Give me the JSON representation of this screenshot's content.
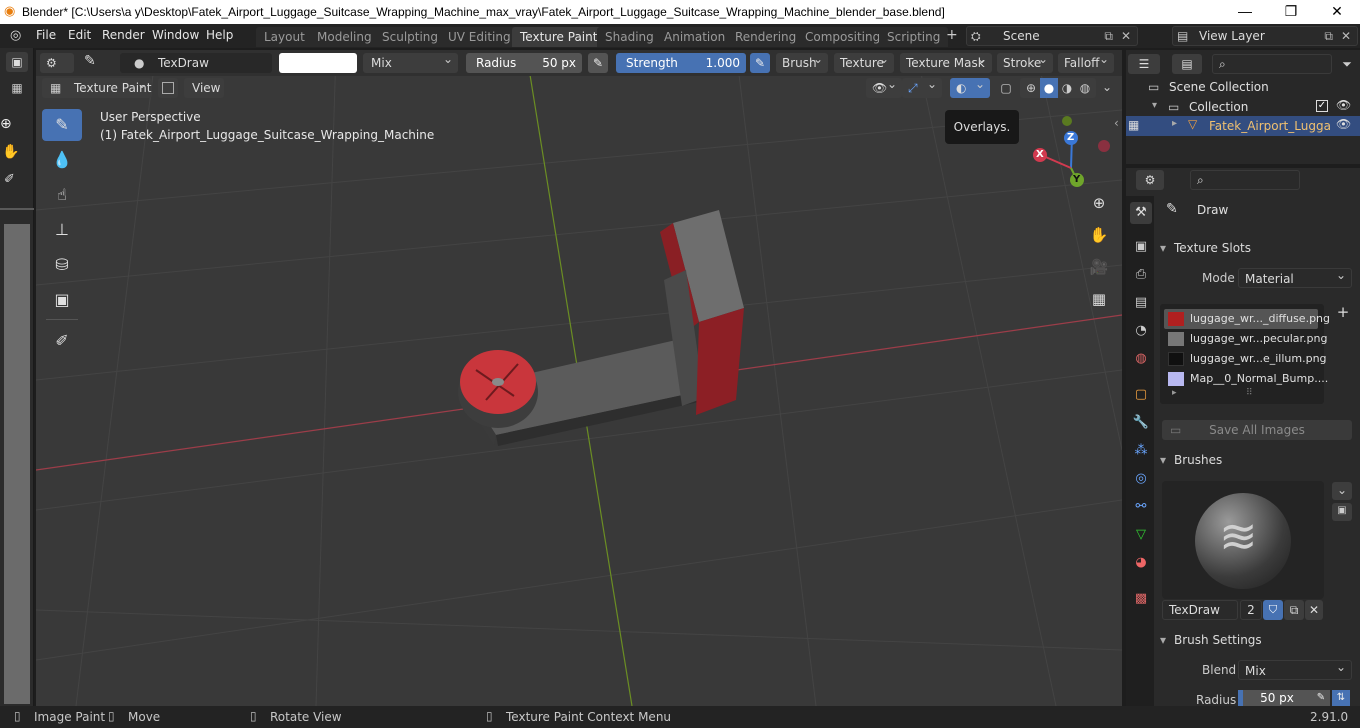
{
  "window": {
    "title": "Blender* [C:\\Users\\a y\\Desktop\\Fatek_Airport_Luggage_Suitcase_Wrapping_Machine_max_vray\\Fatek_Airport_Luggage_Suitcase_Wrapping_Machine_blender_base.blend]",
    "minimize": "—",
    "maximize": "❐",
    "close": "✕"
  },
  "menu": {
    "items": [
      "File",
      "Edit",
      "Render",
      "Window",
      "Help"
    ],
    "workspaces": [
      "Layout",
      "Modeling",
      "Sculpting",
      "UV Editing",
      "Texture Paint",
      "Shading",
      "Animation",
      "Rendering",
      "Compositing",
      "Scripting"
    ],
    "active_workspace": "Texture Paint",
    "add_tab": "+",
    "scene_label": "Scene",
    "view_layer_label": "View Layer"
  },
  "tool_header": {
    "brush_name": "TexDraw",
    "blend_mode": "Mix",
    "radius_label": "Radius",
    "radius_value": "50 px",
    "strength_label": "Strength",
    "strength_value": "1.000",
    "menus": [
      "Brush",
      "Texture",
      "Texture Mask",
      "Stroke",
      "Falloff"
    ]
  },
  "view_header": {
    "mode": "Texture Paint",
    "view_menu": "View"
  },
  "viewport": {
    "perspective": "User Perspective",
    "object_info": "(1) Fatek_Airport_Luggage_Suitcase_Wrapping_Machine",
    "tooltip": "Overlays.",
    "gizmo": {
      "x": "X",
      "y": "Y",
      "z": "Z"
    },
    "colors": {
      "bg": "#393939",
      "grid": "#4a4a4a",
      "x_axis": "#9c3d49",
      "y_axis": "#6b8e23"
    }
  },
  "tools": [
    {
      "name": "draw-tool",
      "glyph": "✎",
      "active": true
    },
    {
      "name": "soften-tool",
      "glyph": "💧",
      "active": false
    },
    {
      "name": "smear-tool",
      "glyph": "☝",
      "active": false
    },
    {
      "name": "clone-tool",
      "glyph": "⊥",
      "active": false
    },
    {
      "name": "fill-tool",
      "glyph": "⛁",
      "active": false
    },
    {
      "name": "mask-tool",
      "glyph": "▣",
      "active": false
    },
    {
      "name": "annotate-tool",
      "glyph": "✐",
      "active": false
    }
  ],
  "outliner": {
    "scene_collection": "Scene Collection",
    "collection": "Collection",
    "object": "Fatek_Airport_Lugga"
  },
  "properties": {
    "active_tool": "Draw",
    "texture_slots_title": "Texture Slots",
    "mode_label": "Mode",
    "mode_value": "Material",
    "slots": [
      {
        "label": "luggage_wr..._diffuse.png",
        "swatch": "#b02020",
        "selected": true
      },
      {
        "label": "luggage_wr...pecular.png",
        "swatch": "#777777",
        "selected": false
      },
      {
        "label": "luggage_wr...e_illum.png",
        "swatch": "#101010",
        "selected": false
      },
      {
        "label": "Map__0_Normal_Bump....",
        "swatch": "#b8b8f0",
        "selected": false
      }
    ],
    "save_all_images": "Save All Images",
    "brushes_title": "Brushes",
    "brush_name": "TexDraw",
    "brush_users": "2",
    "brush_settings_title": "Brush Settings",
    "blend_label": "Blend",
    "blend_value": "Mix",
    "radius_label": "Radius",
    "radius_value": "50 px"
  },
  "status": {
    "left_click": "Image Paint",
    "middle": "Move",
    "rotate": "Rotate View",
    "right_click": "Texture Paint Context Menu",
    "version": "2.91.0"
  }
}
